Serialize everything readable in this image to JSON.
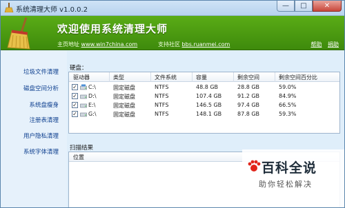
{
  "window": {
    "title": "系统清理大师 v1.0.0.2",
    "buttons": [
      "—",
      "□",
      "✕"
    ]
  },
  "banner": {
    "title": "欢迎使用系统清理大师",
    "homepage_label": "主页地址",
    "homepage_url": "www.win7china.com",
    "community_label": "支持社区",
    "community_url": "bbs.ruanmei.com",
    "help": "帮助",
    "donate": "捐助"
  },
  "sidebar": {
    "items": [
      {
        "label": "垃圾文件清理"
      },
      {
        "label": "磁盘空间分析"
      },
      {
        "label": "系统盘瘦身"
      },
      {
        "label": "注册表清理"
      },
      {
        "label": "用户隐私清理"
      },
      {
        "label": "系统字体清理"
      }
    ]
  },
  "disks": {
    "group_label": "硬盘：",
    "columns": [
      "驱动器",
      "类型",
      "文件系统",
      "容量",
      "剩余空间",
      "剩余空间百分比"
    ],
    "rows": [
      {
        "checked": true,
        "drive": "C:\\",
        "type": "固定磁盘",
        "fs": "NTFS",
        "capacity": "48.8 GB",
        "free": "28.8 GB",
        "percent": "59.0%"
      },
      {
        "checked": true,
        "drive": "D:\\",
        "type": "固定磁盘",
        "fs": "NTFS",
        "capacity": "107.4 GB",
        "free": "91.2 GB",
        "percent": "84.9%"
      },
      {
        "checked": true,
        "drive": "E:\\",
        "type": "固定磁盘",
        "fs": "NTFS",
        "capacity": "146.5 GB",
        "free": "97.4 GB",
        "percent": "66.5%"
      },
      {
        "checked": true,
        "drive": "G:\\",
        "type": "固定磁盘",
        "fs": "NTFS",
        "capacity": "148.1 GB",
        "free": "87.8 GB",
        "percent": "59.3%"
      }
    ]
  },
  "scan": {
    "group_label": "扫描结果",
    "columns": [
      "位置"
    ]
  },
  "watermark": {
    "logo": "百科全说",
    "sub": "助你轻松解决"
  }
}
